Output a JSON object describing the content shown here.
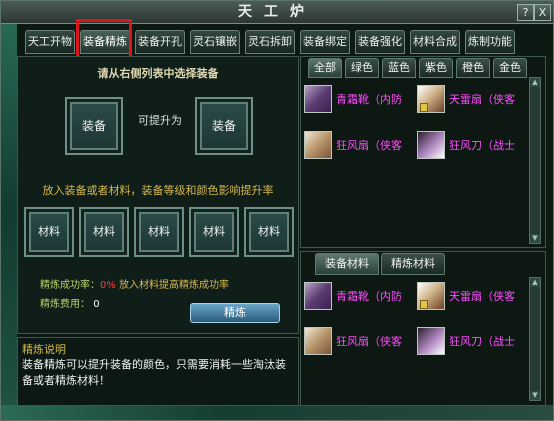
{
  "window": {
    "title": "天工炉",
    "help_label": "?",
    "close_label": "X"
  },
  "tabs": [
    {
      "label": "天工开物",
      "active": false
    },
    {
      "label": "装备精炼",
      "active": true
    },
    {
      "label": "装备开孔",
      "active": false
    },
    {
      "label": "灵石镶嵌",
      "active": false
    },
    {
      "label": "灵石拆卸",
      "active": false
    },
    {
      "label": "装备绑定",
      "active": false
    },
    {
      "label": "装备强化",
      "active": false
    },
    {
      "label": "材料合成",
      "active": false
    },
    {
      "label": "炼制功能",
      "active": false
    }
  ],
  "refine": {
    "hint": "请从右侧列表中选择装备",
    "equip_slot_label": "装备",
    "upgrade_label": "可提升为",
    "result_slot_label": "装备",
    "material_hint": "放入装备或者材料，装备等级和颜色影响提升率",
    "material_slots": [
      "材料",
      "材料",
      "材料",
      "材料",
      "材料"
    ],
    "success_rate_label": "精炼成功率：",
    "success_rate_value": "0%",
    "success_rate_tip": "放入材料提高精炼成功率",
    "cost_label": "精炼费用：",
    "cost_value": "0",
    "refine_button": "精炼"
  },
  "description": {
    "title": "精炼说明",
    "text": "装备精炼可以提升装备的颜色，只需要消耗一些淘汰装备或者精炼材料！"
  },
  "filter_tabs": [
    {
      "label": "全部",
      "active": true
    },
    {
      "label": "绿色",
      "active": false
    },
    {
      "label": "蓝色",
      "active": false
    },
    {
      "label": "紫色",
      "active": false
    },
    {
      "label": "橙色",
      "active": false
    },
    {
      "label": "金色",
      "active": false
    }
  ],
  "equipment_list": [
    {
      "name": "青霜靴（内防",
      "icon": "boots-icon"
    },
    {
      "name": "天雷扇（侠客",
      "icon": "fan-icon"
    },
    {
      "name": "狂风扇（侠客",
      "icon": "fan-icon"
    },
    {
      "name": "狂风刀（战士",
      "icon": "blade-icon"
    }
  ],
  "bottom_tabs": [
    {
      "label": "装备材料",
      "active": true
    },
    {
      "label": "精炼材料",
      "active": false
    }
  ],
  "material_list": [
    {
      "name": "青霜靴（内防",
      "icon": "boots-icon"
    },
    {
      "name": "天雷扇（侠客",
      "icon": "fan-icon"
    },
    {
      "name": "狂风扇（侠客",
      "icon": "fan-icon"
    },
    {
      "name": "狂风刀（战士",
      "icon": "blade-icon"
    }
  ],
  "colors": {
    "item_name": "#ff4cff",
    "success_rate": "#ff3b3b",
    "hint_gold": "#d6b74e",
    "highlight_box": "#e01414"
  }
}
